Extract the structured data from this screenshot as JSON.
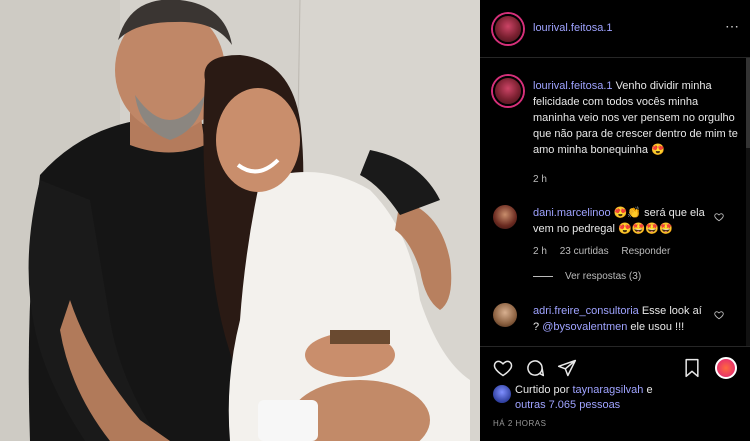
{
  "post": {
    "author": "lourival.feitosa.1",
    "more_label": "⋯",
    "caption_user": "lourival.feitosa.1",
    "caption_text": "Venho dividir minha felicidade com todos vocês minha maninha veio nos ver pensem no orgulho que não para de crescer dentro de mim te amo minha bonequinha 😍",
    "caption_time": "2 h"
  },
  "comments": [
    {
      "user": "dani.marcelinoo",
      "text": "😍👏 será que ela vem no pedregal 😍🤩🤩🤩",
      "time": "2 h",
      "likes": "23 curtidas",
      "reply": "Responder",
      "view_replies": "Ver respostas (3)"
    },
    {
      "user": "adri.freire_consultoria",
      "text_pre": "Esse look aí ?",
      "mention": "@bysovalentmen",
      "text_post": "ele usou !!!"
    }
  ],
  "likes": {
    "prefix": "Curtido por",
    "user": "taynaragsilvah",
    "conj": "e",
    "others": "outras 7.065 pessoas"
  },
  "timestamp": "HÁ 2 HORAS",
  "icons": {
    "like": "heart-icon",
    "comment": "comment-icon",
    "share": "share-icon",
    "save": "bookmark-icon",
    "extension": "extension-icon"
  },
  "colors": {
    "username": "#9fa3ff",
    "background": "#000000",
    "ring": "#d6307a"
  }
}
